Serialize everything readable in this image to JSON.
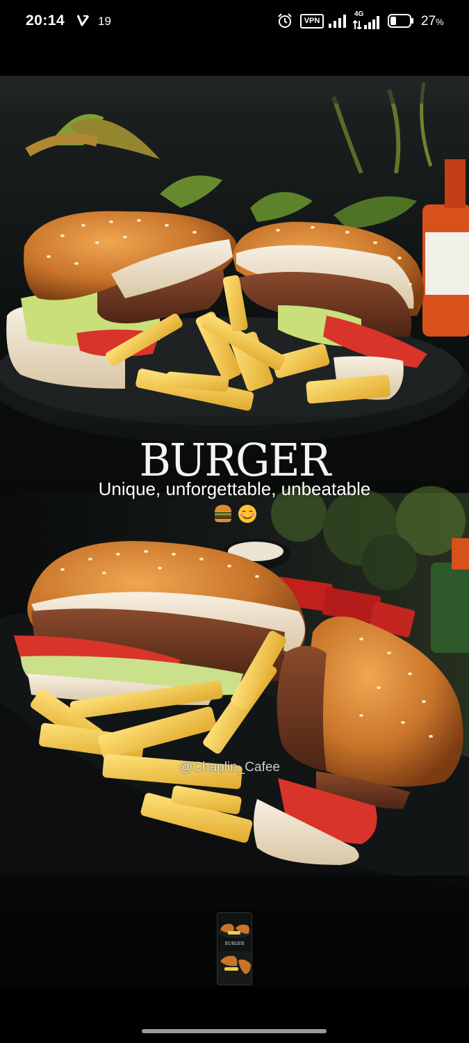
{
  "status_bar": {
    "time": "20:14",
    "notification_count": "19",
    "vpn_label": "VPN",
    "network_type": "4G",
    "battery_percent": "27",
    "battery_unit": "%",
    "battery_level": 0.27,
    "icons": [
      "v-notification-icon",
      "alarm-icon",
      "vpn-icon",
      "signal-icon",
      "4g-signal-icon",
      "battery-icon"
    ]
  },
  "story": {
    "title": "BURGER",
    "tagline": "Unique, unforgettable, unbeatable",
    "emojis": [
      "burger-emoji",
      "smiling-face-emoji"
    ],
    "watermark": "@Chaplin_Cafee"
  },
  "thumbnail": {
    "label": "BURGER"
  },
  "colors": {
    "background": "#000000",
    "bun": "#c8742a",
    "patty": "#6b3a22",
    "fries": "#f2c94c",
    "plate": "#151819",
    "gesture_bar": "#9a9a9a"
  }
}
